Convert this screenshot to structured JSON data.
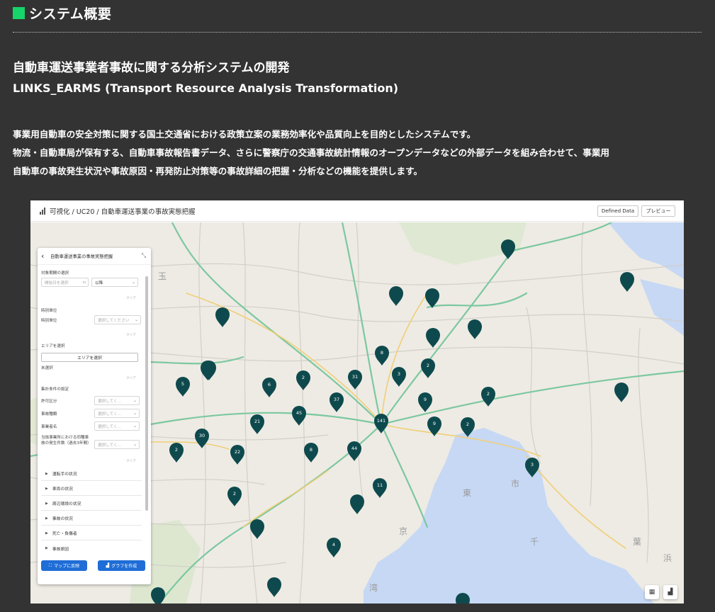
{
  "section": {
    "title": "システム概要",
    "accent": "#16d46a"
  },
  "heading": "自動車運送事業者事故に関する分析システムの開発",
  "subheading": "LINKS_EARMS (Transport Resource Analysis Transformation)",
  "description": [
    "事業用自動車の安全対策に関する国土交通省における政策立案の業務効率化や品質向上を目的としたシステムです。",
    "物流・自動車局が保有する、自動車事故報告書データ、さらに警察庁の交通事故統計情報のオープンデータなどの外部データを組み合わせて、事業用",
    "自動車の事故発生状況や事故原因・再発防止対策等の事故詳細の把握・分析などの機能を提供します。"
  ],
  "app": {
    "breadcrumb": "可視化 / UC20 / 自動車運送事業の事故実態把握",
    "defined_data_button": "Defined Data",
    "preview_button": "プレビュー",
    "panel": {
      "title": "自動車運送事業の事故実態把握",
      "period_label": "対象期間の選択",
      "start_date_placeholder": "開始日を選択",
      "after_select": "以降",
      "clear": "クリア",
      "time_unit_heading": "時別単位",
      "time_unit_label": "時別単位",
      "select_placeholder": "選択してください",
      "area_heading": "エリアを選択",
      "area_button": "エリアを選択",
      "area_status": "未選択",
      "agg_heading": "集計条件の設定",
      "permit_label": "許可区分",
      "accident_type_label": "事故種類",
      "operator_label": "事業者名",
      "same_type_label": "当該事業所における同種事故の発生件数（過去3年間）",
      "short_placeholder": "選択してく...",
      "sections": [
        "運転手の状況",
        "車両の状況",
        "周辺環境の状況",
        "事故の状況",
        "死亡・負傷者",
        "事故原因"
      ],
      "reflect_button": "マップに反映",
      "graph_button": "グラフを作成"
    },
    "map": {
      "pin_color": "#0e4a4d",
      "water_color": "#c6d8f4",
      "pins": [
        {
          "label": ""
        },
        {
          "label": ""
        },
        {
          "label": ""
        },
        {
          "label": ""
        },
        {
          "label": ""
        },
        {
          "label": ""
        },
        {
          "label": ""
        },
        {
          "label": "8"
        },
        {
          "label": "2"
        },
        {
          "label": "3"
        },
        {
          "label": "5"
        },
        {
          "label": "6"
        },
        {
          "label": "2"
        },
        {
          "label": "31"
        },
        {
          "label": "2"
        },
        {
          "label": ""
        },
        {
          "label": "37"
        },
        {
          "label": "9"
        },
        {
          "label": "45"
        },
        {
          "label": "21"
        },
        {
          "label": "141"
        },
        {
          "label": "9"
        },
        {
          "label": "2"
        },
        {
          "label": "30"
        },
        {
          "label": "2"
        },
        {
          "label": "22"
        },
        {
          "label": "8"
        },
        {
          "label": "44"
        },
        {
          "label": "3"
        },
        {
          "label": "11"
        },
        {
          "label": "2"
        },
        {
          "label": ""
        },
        {
          "label": ""
        },
        {
          "label": "4"
        },
        {
          "label": ""
        },
        {
          "label": ""
        },
        {
          "label": ""
        },
        {
          "label": ""
        },
        {
          "label": ""
        }
      ],
      "place_labels": [
        "玉",
        "東",
        "京",
        "湾",
        "千",
        "葉",
        "市",
        "浜"
      ]
    }
  }
}
